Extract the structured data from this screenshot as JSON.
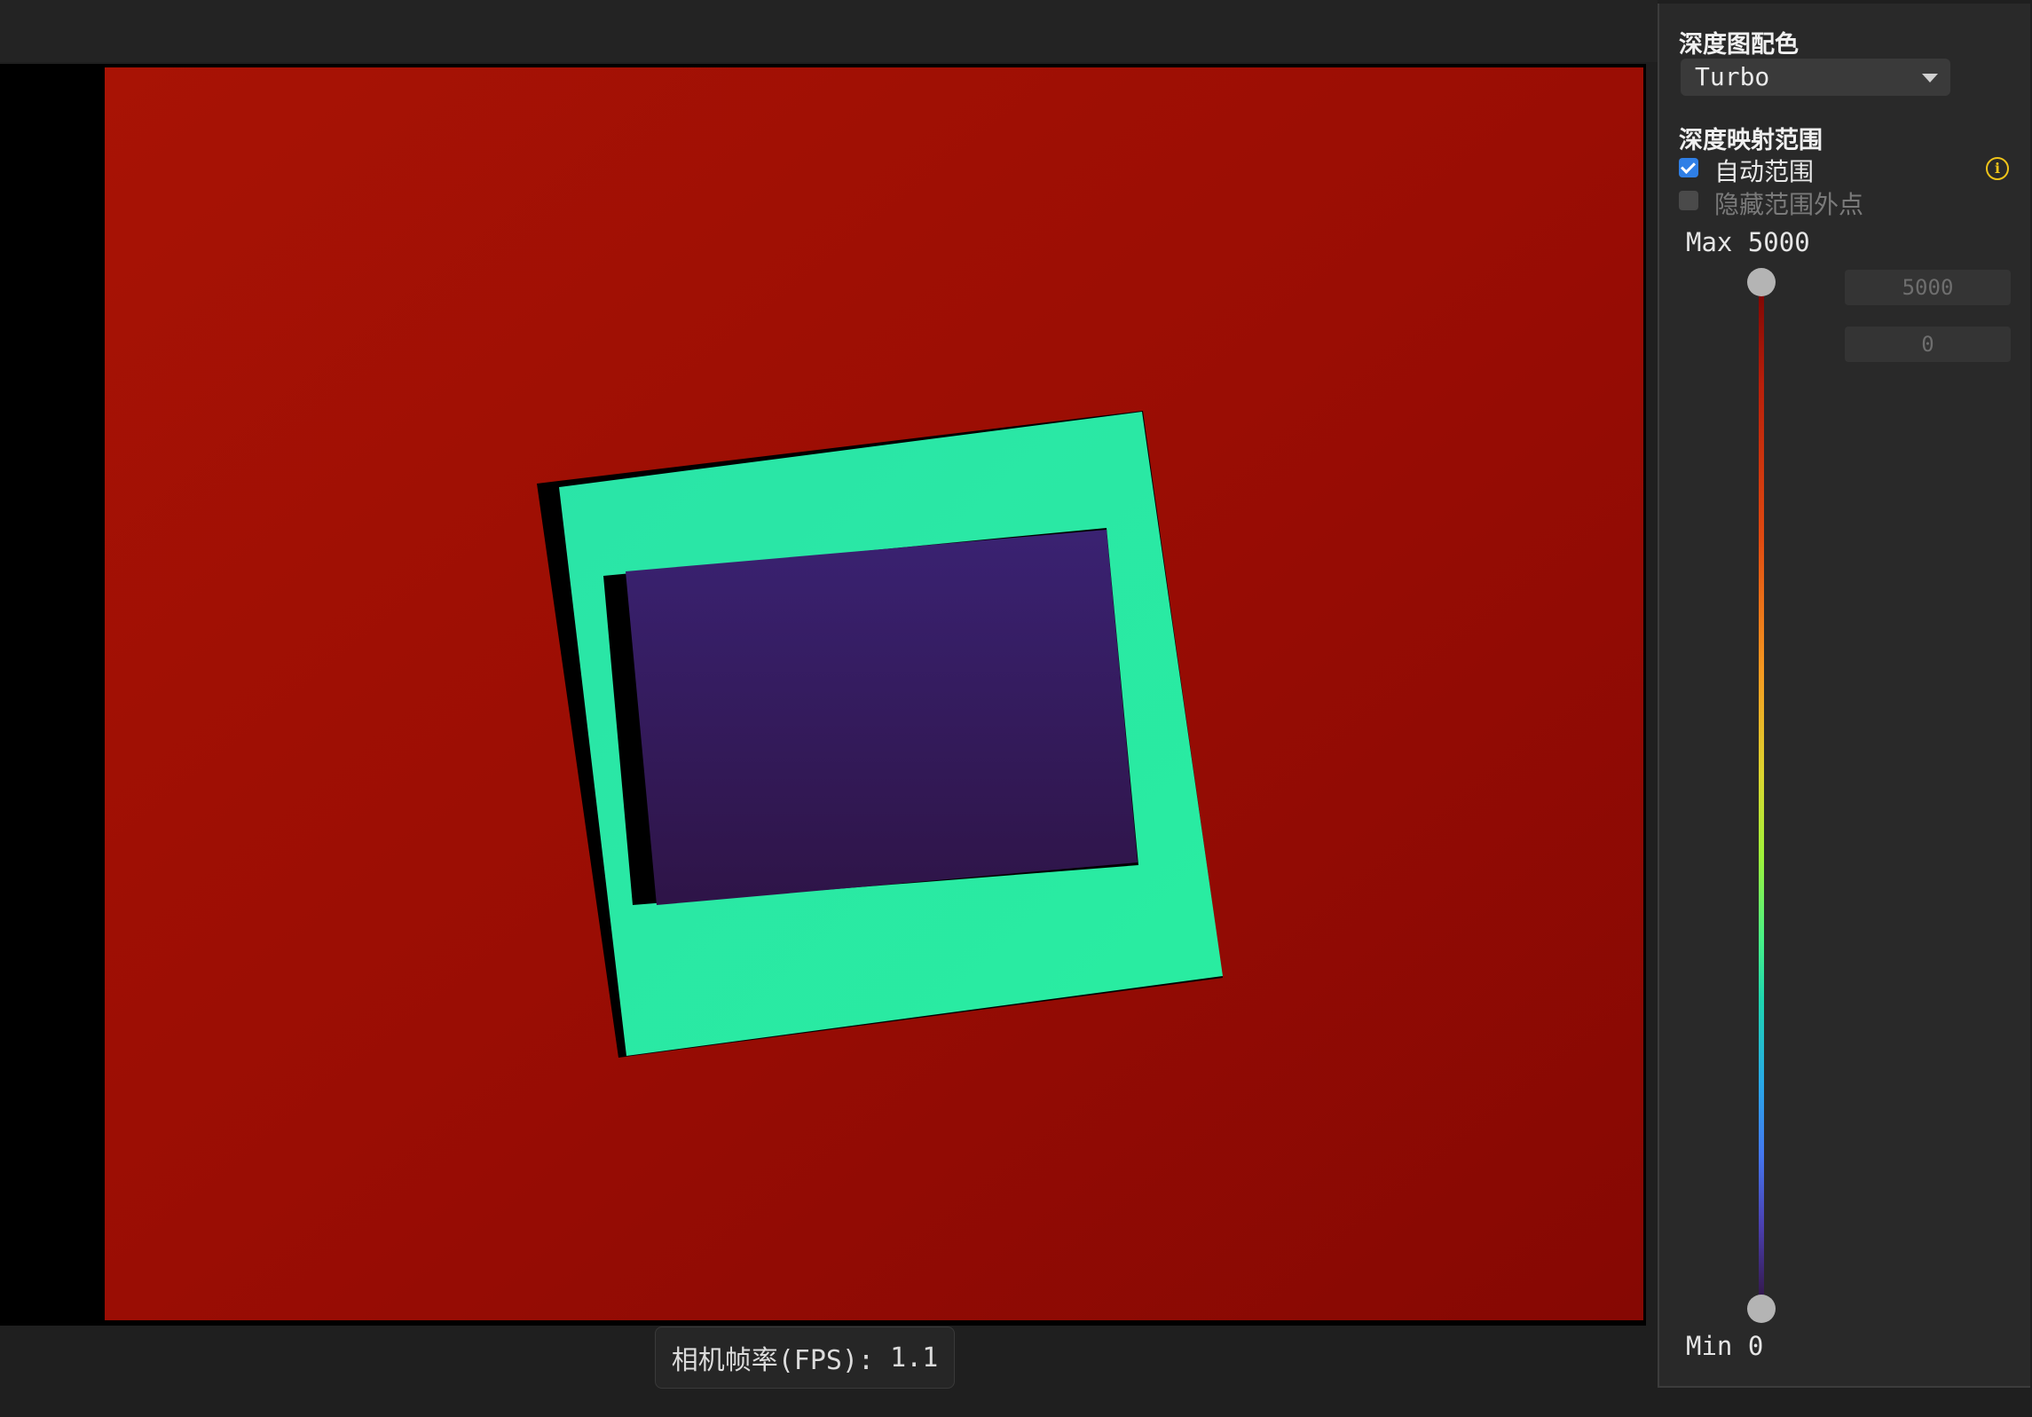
{
  "side_panel": {
    "colormap_title": "深度图配色",
    "colormap_selected": "Turbo",
    "range_title": "深度映射范围",
    "auto_range_label": "自动范围",
    "auto_range_checked": true,
    "hide_outside_label": "隐藏范围外点",
    "hide_outside_checked": false,
    "max_label": "Max 5000",
    "min_label": "Min 0",
    "max_value": "5000",
    "min_value": "0",
    "info_icon": "info-icon"
  },
  "status": {
    "fps_label": "相机帧率(FPS):",
    "fps_value": "1.1"
  },
  "colors": {
    "background": "#7a0403",
    "frame_inner": "#26e8a6",
    "center_block": "#30123b",
    "accent": "#2f7fe6",
    "info": "#f0c419"
  }
}
